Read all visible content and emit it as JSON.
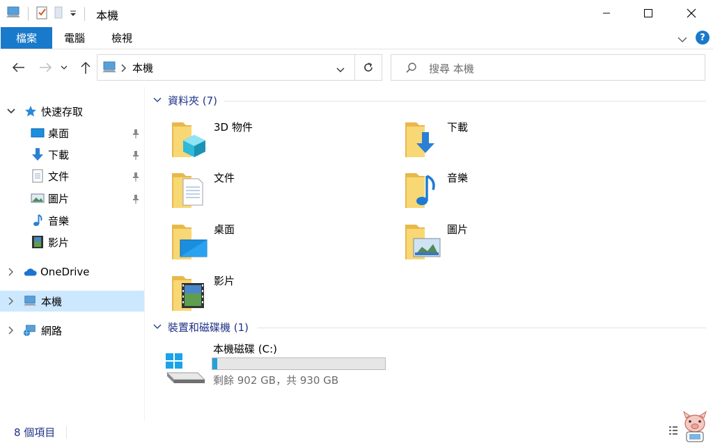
{
  "window": {
    "title": "本機",
    "minimize_label": "最小化",
    "maximize_label": "最大化",
    "close_label": "關閉"
  },
  "ribbon": {
    "file_tab": "檔案",
    "tabs": [
      "電腦",
      "檢視"
    ],
    "help": "?"
  },
  "address": {
    "crumb": "本機",
    "search_placeholder": "搜尋 本機"
  },
  "nav": {
    "quick_access": "快速存取",
    "quick_items": [
      {
        "label": "桌面",
        "icon": "desktop-icon",
        "pinned": true
      },
      {
        "label": "下載",
        "icon": "download-icon",
        "pinned": true
      },
      {
        "label": "文件",
        "icon": "document-icon",
        "pinned": true
      },
      {
        "label": "圖片",
        "icon": "picture-icon",
        "pinned": true
      },
      {
        "label": "音樂",
        "icon": "music-icon",
        "pinned": false
      },
      {
        "label": "影片",
        "icon": "video-icon",
        "pinned": false
      }
    ],
    "onedrive": "OneDrive",
    "this_pc": "本機",
    "network": "網路"
  },
  "folders_group": {
    "title": "資料夾 (7)",
    "items": [
      {
        "label": "3D 物件",
        "icon": "3d-objects-folder-icon"
      },
      {
        "label": "下載",
        "icon": "downloads-folder-icon"
      },
      {
        "label": "文件",
        "icon": "documents-folder-icon"
      },
      {
        "label": "音樂",
        "icon": "music-folder-icon"
      },
      {
        "label": "桌面",
        "icon": "desktop-folder-icon"
      },
      {
        "label": "圖片",
        "icon": "pictures-folder-icon"
      },
      {
        "label": "影片",
        "icon": "videos-folder-icon"
      }
    ]
  },
  "drives_group": {
    "title": "裝置和磁碟機 (1)",
    "drive": {
      "name": "本機磁碟 (C:)",
      "free_text": "剩餘 902 GB，共 930 GB",
      "used_fraction": 0.03
    }
  },
  "status": {
    "item_count": "8 個項目"
  },
  "colors": {
    "accent": "#1979ca",
    "selected_bg": "#cce8ff",
    "group_header": "#1e3287",
    "folder_yellow": "#f8d775",
    "drive_fill": "#26a0da"
  }
}
